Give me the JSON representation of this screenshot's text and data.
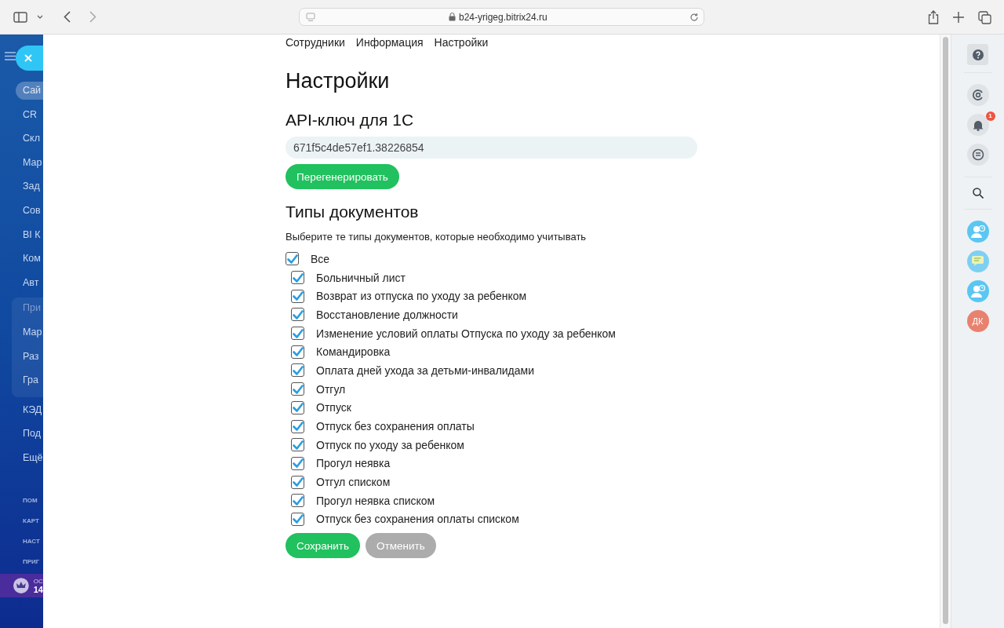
{
  "browser": {
    "url": "b24-yrigeg.bitrix24.ru"
  },
  "sidebar": {
    "items": [
      {
        "label": "Сай",
        "selected": true,
        "group": false
      },
      {
        "label": "CR",
        "selected": false,
        "group": false
      },
      {
        "label": "Скл",
        "selected": false,
        "group": false
      },
      {
        "label": "Мар",
        "selected": false,
        "group": false
      },
      {
        "label": "Зад",
        "selected": false,
        "group": false
      },
      {
        "label": "Сов",
        "selected": false,
        "group": false
      },
      {
        "label": "BI К",
        "selected": false,
        "group": false
      },
      {
        "label": "Ком",
        "selected": false,
        "group": false
      },
      {
        "label": "Авт",
        "selected": false,
        "group": false
      },
      {
        "label": "При",
        "selected": false,
        "group": true
      },
      {
        "label": "Мар",
        "selected": false,
        "group": true
      },
      {
        "label": "Раз",
        "selected": false,
        "group": true
      },
      {
        "label": "Гра",
        "selected": false,
        "group": true
      },
      {
        "label": "КЭД",
        "selected": false,
        "group": false
      },
      {
        "label": "Под",
        "selected": false,
        "group": false
      },
      {
        "label": "Ещё",
        "selected": false,
        "group": false
      }
    ],
    "links": [
      "ПОМ",
      "КАРТ",
      "НАСТ",
      "ПРИГ"
    ],
    "plan": {
      "line_1": "ОС",
      "line_2": "14"
    }
  },
  "nav": [
    "Сотрудники",
    "Информация",
    "Настройки"
  ],
  "title": "Настройки",
  "api": {
    "heading": "API-ключ для 1С",
    "value": "671f5c4de57ef1.38226854",
    "button": "Перегенерировать"
  },
  "doc_types": {
    "heading": "Типы документов",
    "hint": "Выберите те типы документов, которые необходимо учитывать",
    "all": {
      "label": "Все",
      "checked": true
    },
    "items": [
      {
        "label": "Больничный лист",
        "checked": true
      },
      {
        "label": "Возврат из отпуска по уходу за ребенком",
        "checked": true
      },
      {
        "label": "Восстановление должности",
        "checked": true
      },
      {
        "label": "Изменение условий оплаты Отпуска по уходу за ребенком",
        "checked": true
      },
      {
        "label": "Командировка",
        "checked": true
      },
      {
        "label": "Оплата дней ухода за детьми-инвалидами",
        "checked": true
      },
      {
        "label": "Отгул",
        "checked": true
      },
      {
        "label": "Отпуск",
        "checked": true
      },
      {
        "label": "Отпуск без сохранения оплаты",
        "checked": true
      },
      {
        "label": "Отпуск по уходу за ребенком",
        "checked": true
      },
      {
        "label": "Прогул неявка",
        "checked": true
      },
      {
        "label": "Отгул списком",
        "checked": true
      },
      {
        "label": "Прогул неявка списком",
        "checked": true
      },
      {
        "label": "Отпуск без сохранения оплаты списком",
        "checked": true
      }
    ]
  },
  "actions": [
    {
      "label": "Сохранить",
      "kind": "primary"
    },
    {
      "label": "Отменить",
      "kind": "secondary"
    }
  ],
  "right_panel": {
    "notification_badge": "1",
    "avatar": "ДК"
  }
}
